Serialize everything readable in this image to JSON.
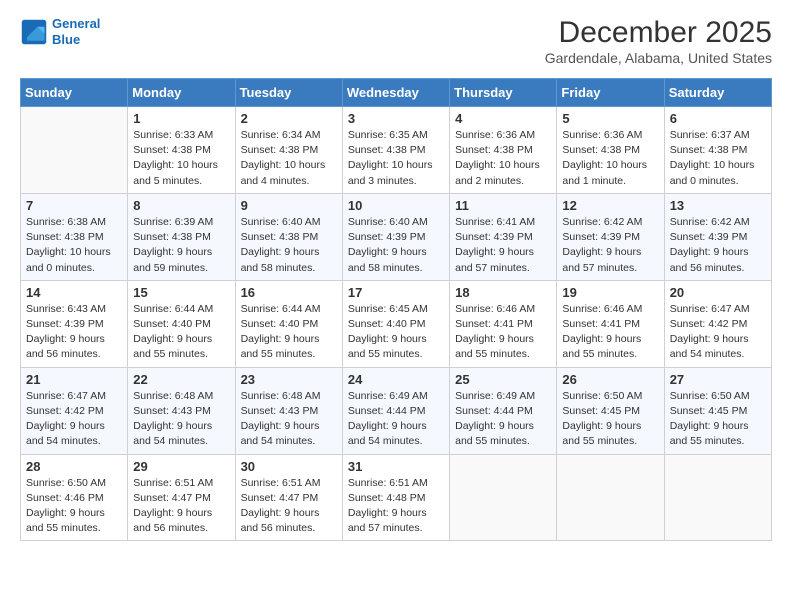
{
  "header": {
    "logo_line1": "General",
    "logo_line2": "Blue",
    "title": "December 2025",
    "location": "Gardendale, Alabama, United States"
  },
  "weekdays": [
    "Sunday",
    "Monday",
    "Tuesday",
    "Wednesday",
    "Thursday",
    "Friday",
    "Saturday"
  ],
  "weeks": [
    [
      {
        "day": "",
        "info": ""
      },
      {
        "day": "1",
        "info": "Sunrise: 6:33 AM\nSunset: 4:38 PM\nDaylight: 10 hours\nand 5 minutes."
      },
      {
        "day": "2",
        "info": "Sunrise: 6:34 AM\nSunset: 4:38 PM\nDaylight: 10 hours\nand 4 minutes."
      },
      {
        "day": "3",
        "info": "Sunrise: 6:35 AM\nSunset: 4:38 PM\nDaylight: 10 hours\nand 3 minutes."
      },
      {
        "day": "4",
        "info": "Sunrise: 6:36 AM\nSunset: 4:38 PM\nDaylight: 10 hours\nand 2 minutes."
      },
      {
        "day": "5",
        "info": "Sunrise: 6:36 AM\nSunset: 4:38 PM\nDaylight: 10 hours\nand 1 minute."
      },
      {
        "day": "6",
        "info": "Sunrise: 6:37 AM\nSunset: 4:38 PM\nDaylight: 10 hours\nand 0 minutes."
      }
    ],
    [
      {
        "day": "7",
        "info": "Sunrise: 6:38 AM\nSunset: 4:38 PM\nDaylight: 10 hours\nand 0 minutes."
      },
      {
        "day": "8",
        "info": "Sunrise: 6:39 AM\nSunset: 4:38 PM\nDaylight: 9 hours\nand 59 minutes."
      },
      {
        "day": "9",
        "info": "Sunrise: 6:40 AM\nSunset: 4:38 PM\nDaylight: 9 hours\nand 58 minutes."
      },
      {
        "day": "10",
        "info": "Sunrise: 6:40 AM\nSunset: 4:39 PM\nDaylight: 9 hours\nand 58 minutes."
      },
      {
        "day": "11",
        "info": "Sunrise: 6:41 AM\nSunset: 4:39 PM\nDaylight: 9 hours\nand 57 minutes."
      },
      {
        "day": "12",
        "info": "Sunrise: 6:42 AM\nSunset: 4:39 PM\nDaylight: 9 hours\nand 57 minutes."
      },
      {
        "day": "13",
        "info": "Sunrise: 6:42 AM\nSunset: 4:39 PM\nDaylight: 9 hours\nand 56 minutes."
      }
    ],
    [
      {
        "day": "14",
        "info": "Sunrise: 6:43 AM\nSunset: 4:39 PM\nDaylight: 9 hours\nand 56 minutes."
      },
      {
        "day": "15",
        "info": "Sunrise: 6:44 AM\nSunset: 4:40 PM\nDaylight: 9 hours\nand 55 minutes."
      },
      {
        "day": "16",
        "info": "Sunrise: 6:44 AM\nSunset: 4:40 PM\nDaylight: 9 hours\nand 55 minutes."
      },
      {
        "day": "17",
        "info": "Sunrise: 6:45 AM\nSunset: 4:40 PM\nDaylight: 9 hours\nand 55 minutes."
      },
      {
        "day": "18",
        "info": "Sunrise: 6:46 AM\nSunset: 4:41 PM\nDaylight: 9 hours\nand 55 minutes."
      },
      {
        "day": "19",
        "info": "Sunrise: 6:46 AM\nSunset: 4:41 PM\nDaylight: 9 hours\nand 55 minutes."
      },
      {
        "day": "20",
        "info": "Sunrise: 6:47 AM\nSunset: 4:42 PM\nDaylight: 9 hours\nand 54 minutes."
      }
    ],
    [
      {
        "day": "21",
        "info": "Sunrise: 6:47 AM\nSunset: 4:42 PM\nDaylight: 9 hours\nand 54 minutes."
      },
      {
        "day": "22",
        "info": "Sunrise: 6:48 AM\nSunset: 4:43 PM\nDaylight: 9 hours\nand 54 minutes."
      },
      {
        "day": "23",
        "info": "Sunrise: 6:48 AM\nSunset: 4:43 PM\nDaylight: 9 hours\nand 54 minutes."
      },
      {
        "day": "24",
        "info": "Sunrise: 6:49 AM\nSunset: 4:44 PM\nDaylight: 9 hours\nand 54 minutes."
      },
      {
        "day": "25",
        "info": "Sunrise: 6:49 AM\nSunset: 4:44 PM\nDaylight: 9 hours\nand 55 minutes."
      },
      {
        "day": "26",
        "info": "Sunrise: 6:50 AM\nSunset: 4:45 PM\nDaylight: 9 hours\nand 55 minutes."
      },
      {
        "day": "27",
        "info": "Sunrise: 6:50 AM\nSunset: 4:45 PM\nDaylight: 9 hours\nand 55 minutes."
      }
    ],
    [
      {
        "day": "28",
        "info": "Sunrise: 6:50 AM\nSunset: 4:46 PM\nDaylight: 9 hours\nand 55 minutes."
      },
      {
        "day": "29",
        "info": "Sunrise: 6:51 AM\nSunset: 4:47 PM\nDaylight: 9 hours\nand 56 minutes."
      },
      {
        "day": "30",
        "info": "Sunrise: 6:51 AM\nSunset: 4:47 PM\nDaylight: 9 hours\nand 56 minutes."
      },
      {
        "day": "31",
        "info": "Sunrise: 6:51 AM\nSunset: 4:48 PM\nDaylight: 9 hours\nand 57 minutes."
      },
      {
        "day": "",
        "info": ""
      },
      {
        "day": "",
        "info": ""
      },
      {
        "day": "",
        "info": ""
      }
    ]
  ]
}
